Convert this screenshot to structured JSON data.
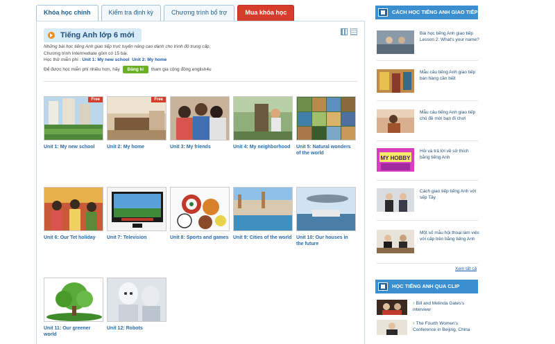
{
  "tabs": [
    {
      "label": "Khóa học chính"
    },
    {
      "label": "Kiểm tra định kỳ"
    },
    {
      "label": "Chương trình bổ trợ"
    },
    {
      "label": "Mua khóa học"
    }
  ],
  "course": {
    "title": "Tiếng Anh lớp 6 mới",
    "desc_line1": "Những bài học tiếng Anh giao tiếp trực tuyến nâng cao dành cho trình độ trung cấp.",
    "desc_line2": "Chương trình Intermediate gồm có 15 bài.",
    "trial_prefix": "Học thử miễn phí :",
    "trial_link1": "Unit 1: My new school",
    "trial_link2": "Unit 2: My home",
    "more_prefix": "Để được học miễn phí nhiều hơn, hãy",
    "signup_label": "Đăng kí",
    "more_suffix": "tham gia cộng đồng english4u"
  },
  "units": [
    {
      "label": "Unit 1: My new school",
      "free": "Free"
    },
    {
      "label": "Unit 2: My home",
      "free": "Free"
    },
    {
      "label": "Unit 3: My friends"
    },
    {
      "label": "Unit 4: My neighborhood"
    },
    {
      "label": "Unit 5: Natural wonders of the world"
    },
    {
      "label": "Unit 6: Our Tet holiday"
    },
    {
      "label": "Unit 7: Television"
    },
    {
      "label": "Unit 8: Sports and games"
    },
    {
      "label": "Unit 9: Cities of the world"
    },
    {
      "label": "Unit 10: Our houses in the future"
    },
    {
      "label": "Unit 11: Our greener world"
    },
    {
      "label": "Unit 12: Robots"
    }
  ],
  "sidebar": {
    "section1_title": "CÁCH HỌC TIẾNG ANH GIAO TIẾP",
    "articles": [
      {
        "title": "Bài học tiếng Anh giao tiếp Lesson 2: What's your name?"
      },
      {
        "title": "Mẫu câu tiếng Anh giao tiếp bán hàng cần biết"
      },
      {
        "title": "Mẫu câu tiếng Anh giao tiếp chủ đề mời bạn đi chơi"
      },
      {
        "title": "Hỏi và trả lời về sở thích bằng tiếng Anh"
      },
      {
        "title": "Cách giao tiếp tiếng Anh với sếp Tây"
      },
      {
        "title": "Một số mẫu hội thoại làm việc với cấp trên bằng tiếng Anh"
      }
    ],
    "see_all": "Xem tất cả",
    "section2_title": "HỌC TIẾNG ANH QUA CLIP",
    "clips": [
      {
        "title": "Bill and Melinda Gates's interview"
      },
      {
        "title": "The Fourth Women's Conference in Beijing, China"
      }
    ]
  },
  "colors": {
    "accent": "#3b8ed0",
    "buy": "#d63c2a",
    "signup": "#6ab023",
    "link": "#2a6aa8"
  }
}
